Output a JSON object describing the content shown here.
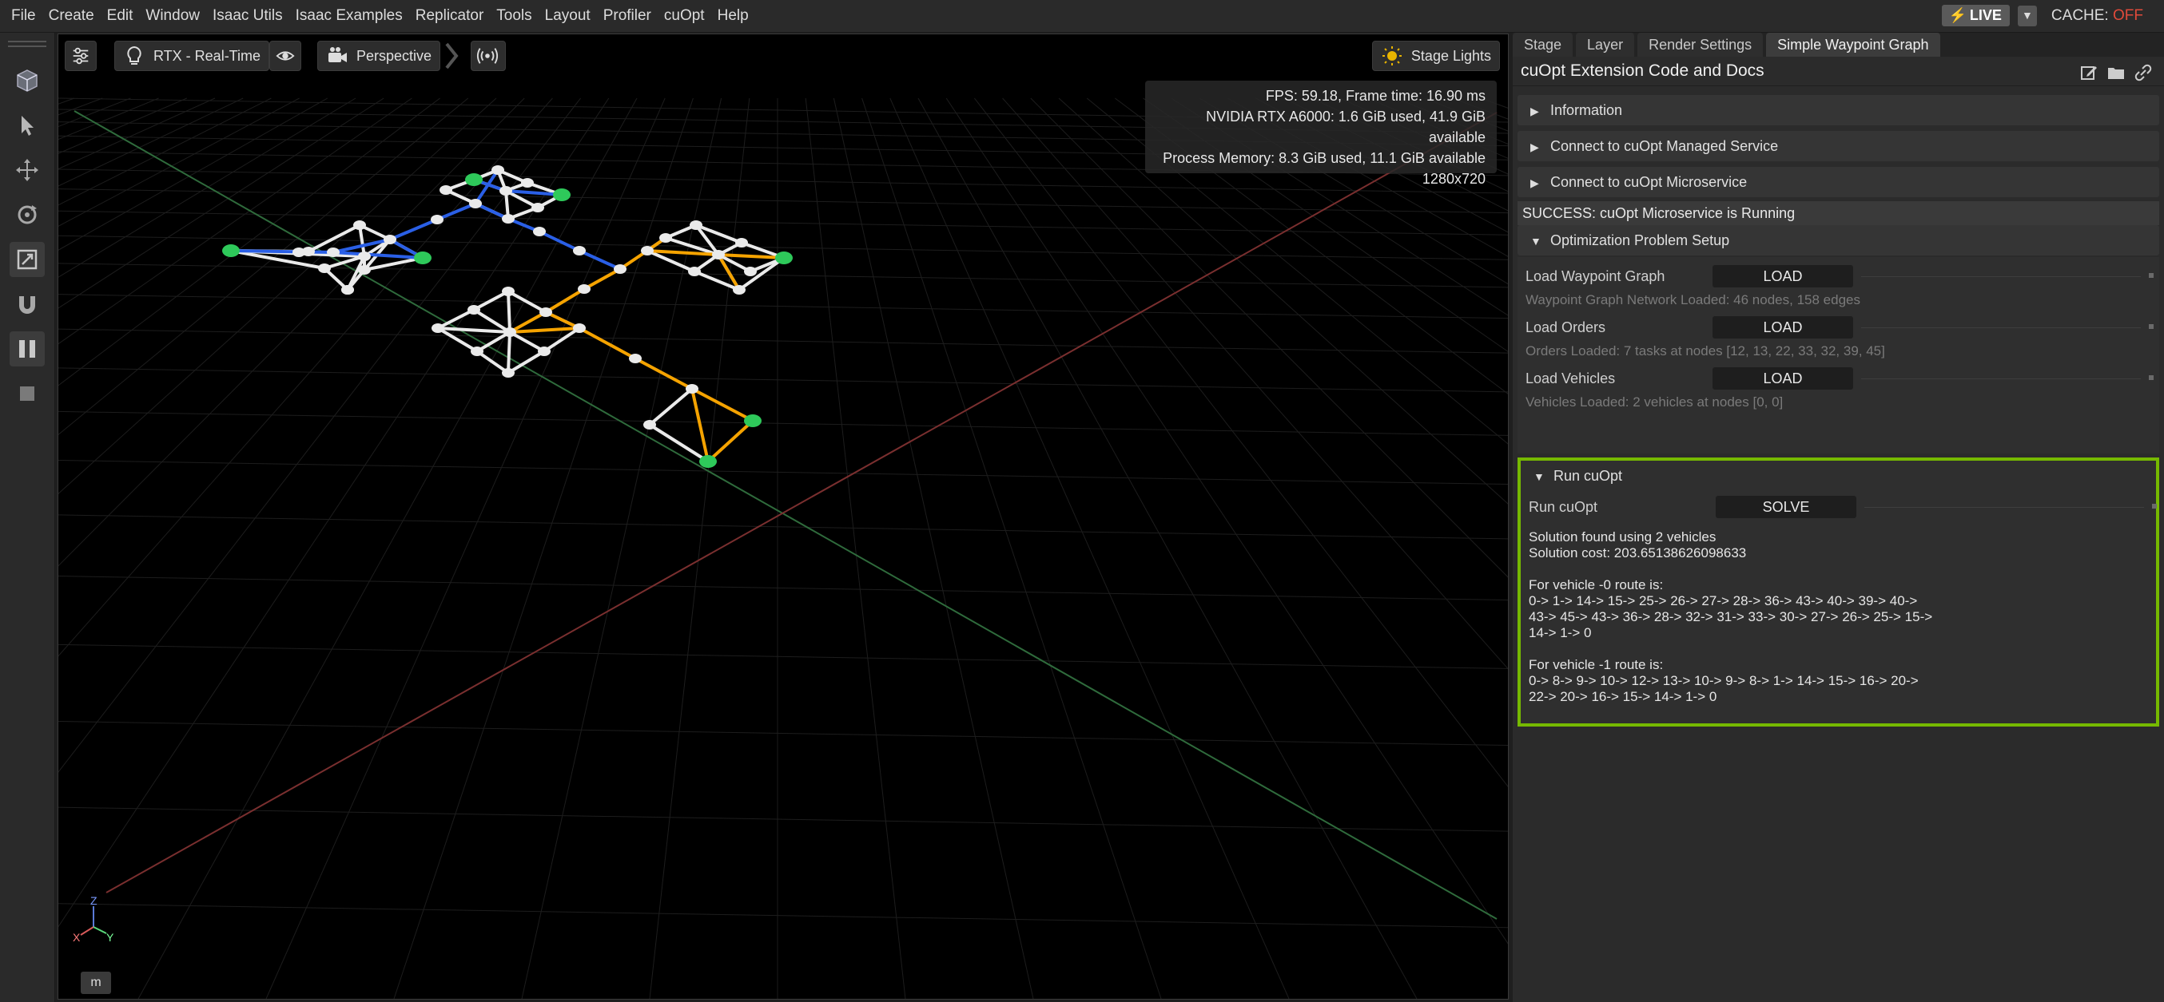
{
  "menubar": {
    "items": [
      "File",
      "Create",
      "Edit",
      "Window",
      "Isaac Utils",
      "Isaac Examples",
      "Replicator",
      "Tools",
      "Layout",
      "Profiler",
      "cuOpt",
      "Help"
    ],
    "live_label": "LIVE",
    "cache_label": "CACHE:",
    "cache_state": "OFF",
    "live_color": "#f5c400",
    "cache_off_color": "#e04a3a"
  },
  "left_toolbar": {
    "icons": [
      "cube-icon",
      "select-arrow-icon",
      "move-icon",
      "rotate-icon",
      "scale-icon",
      "snap-magnet-icon",
      "pause-icon",
      "stop-icon"
    ]
  },
  "viewport": {
    "renderer_label": "RTX - Real-Time",
    "camera_label": "Perspective",
    "lights_label": "Stage Lights",
    "stats": {
      "line1": "FPS: 59.18, Frame time: 16.90 ms",
      "line2": "NVIDIA RTX A6000: 1.6 GiB used, 41.9 GiB available",
      "line3": "Process Memory: 8.3 GiB used, 11.1 GiB available",
      "line4": "1280x720"
    },
    "axis_labels": {
      "z": "Z",
      "x": "X",
      "y": "Y"
    },
    "units_label": "m",
    "route_colors": {
      "vehicle0": "#f5a300",
      "vehicle1": "#2a5fe6",
      "node": "#eaeaea",
      "task_node": "#2ec95a"
    }
  },
  "right_panel": {
    "tabs": [
      "Stage",
      "Layer",
      "Render Settings",
      "Simple Waypoint Graph"
    ],
    "header_title": "cuOpt Extension Code and Docs",
    "sections": {
      "information": "Information",
      "managed_service": "Connect to cuOpt Managed Service",
      "microservice": "Connect to cuOpt Microservice",
      "success": "SUCCESS: cuOpt Microservice is Running",
      "problem_setup": "Optimization Problem Setup",
      "run_cuopt": "Run cuOpt"
    },
    "setup_rows": {
      "waypoint_label": "Load Waypoint Graph",
      "waypoint_btn": "LOAD",
      "waypoint_status": "Waypoint Graph Network Loaded: 46 nodes, 158 edges",
      "orders_label": "Load Orders",
      "orders_btn": "LOAD",
      "orders_status": "Orders Loaded: 7 tasks at nodes [12, 13, 22, 33, 32, 39, 45]",
      "vehicles_label": "Load Vehicles",
      "vehicles_btn": "LOAD",
      "vehicles_status": "Vehicles Loaded: 2 vehicles at nodes [0, 0]"
    },
    "run": {
      "label": "Run cuOpt",
      "button": "SOLVE",
      "solution_text": "Solution found using 2 vehicles\nSolution cost: 203.65138626098633\n\nFor vehicle -0 route is:\n0-> 1-> 14-> 15-> 25-> 26-> 27-> 28-> 36-> 43-> 40-> 39-> 40->\n43-> 45-> 43-> 36-> 28-> 32-> 31-> 33-> 30-> 27-> 26-> 25-> 15->\n14-> 1-> 0\n\nFor vehicle -1 route is:\n0-> 8-> 9-> 10-> 12-> 13-> 10-> 9-> 8-> 1-> 14-> 15-> 16-> 20->\n22-> 20-> 16-> 15-> 14-> 1-> 0",
      "highlight_color": "#76b900"
    }
  }
}
